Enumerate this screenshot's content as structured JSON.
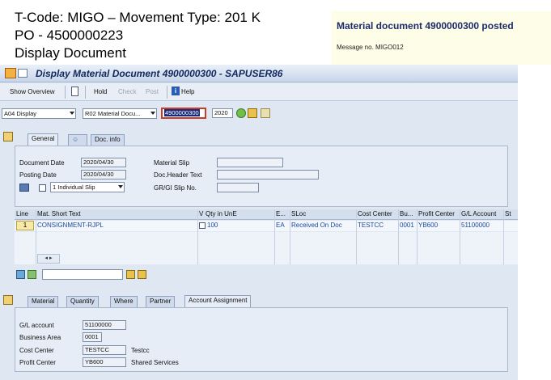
{
  "header": {
    "line1": "T-Code: MIGO – Movement Type: 201 K",
    "line2": "PO - 4500000223",
    "line3": "Display Document"
  },
  "message": {
    "title": "Material document 4900000300 posted",
    "number": "Message no. MIGO012"
  },
  "window": {
    "title": "Display Material Document 4900000300 - SAPUSER86"
  },
  "toolbar": {
    "show_overview": "Show Overview",
    "hold": "Hold",
    "check": "Check",
    "post": "Post",
    "help": "Help"
  },
  "selection": {
    "action": "A04 Display",
    "reference": "R02 Material Docu...",
    "doc_number": "4900000300",
    "year": "2020"
  },
  "header_tabs": [
    "General",
    "Doc. info"
  ],
  "general": {
    "document_date_label": "Document Date",
    "document_date": "2020/04/30",
    "posting_date_label": "Posting Date",
    "posting_date": "2020/04/30",
    "slip_option": "1 Individual Slip",
    "material_slip_label": "Material Slip",
    "doc_header_text_label": "Doc.Header Text",
    "grgi_slip_label": "GR/GI Slip No."
  },
  "item_grid": {
    "columns": [
      "Line",
      "Mat. Short Text",
      "V",
      "Qty in UnE",
      "E...",
      "SLoc",
      "Cost Center",
      "Bu...",
      "Profit Center",
      "G/L Account",
      "St"
    ],
    "rows": [
      {
        "line": "1",
        "text": "CONSIGNMENT-RJPL",
        "qty": "100",
        "unit": "EA",
        "sloc": "Received On Doc",
        "cost_center": "TESTCC",
        "bu": "0001",
        "profit_center": "YB600",
        "gl_account": "51100000"
      }
    ]
  },
  "detail_tabs": [
    "Material",
    "Quantity",
    "Where",
    "Partner",
    "Account Assignment"
  ],
  "account_assignment": {
    "gl_label": "G/L account",
    "gl_value": "51100000",
    "ba_label": "Business Area",
    "ba_value": "0001",
    "cc_label": "Cost Center",
    "cc_value": "TESTCC",
    "cc_desc": "Testcc",
    "pc_label": "Profit Center",
    "pc_value": "YB600",
    "pc_desc": "Shared Services"
  },
  "colors": {
    "sap_bg": "#dfe7f3",
    "title_text": "#10285c",
    "link_blue": "#1b4aa0",
    "message_bg": "#fdfde8",
    "highlight_red": "#c83a2a"
  }
}
